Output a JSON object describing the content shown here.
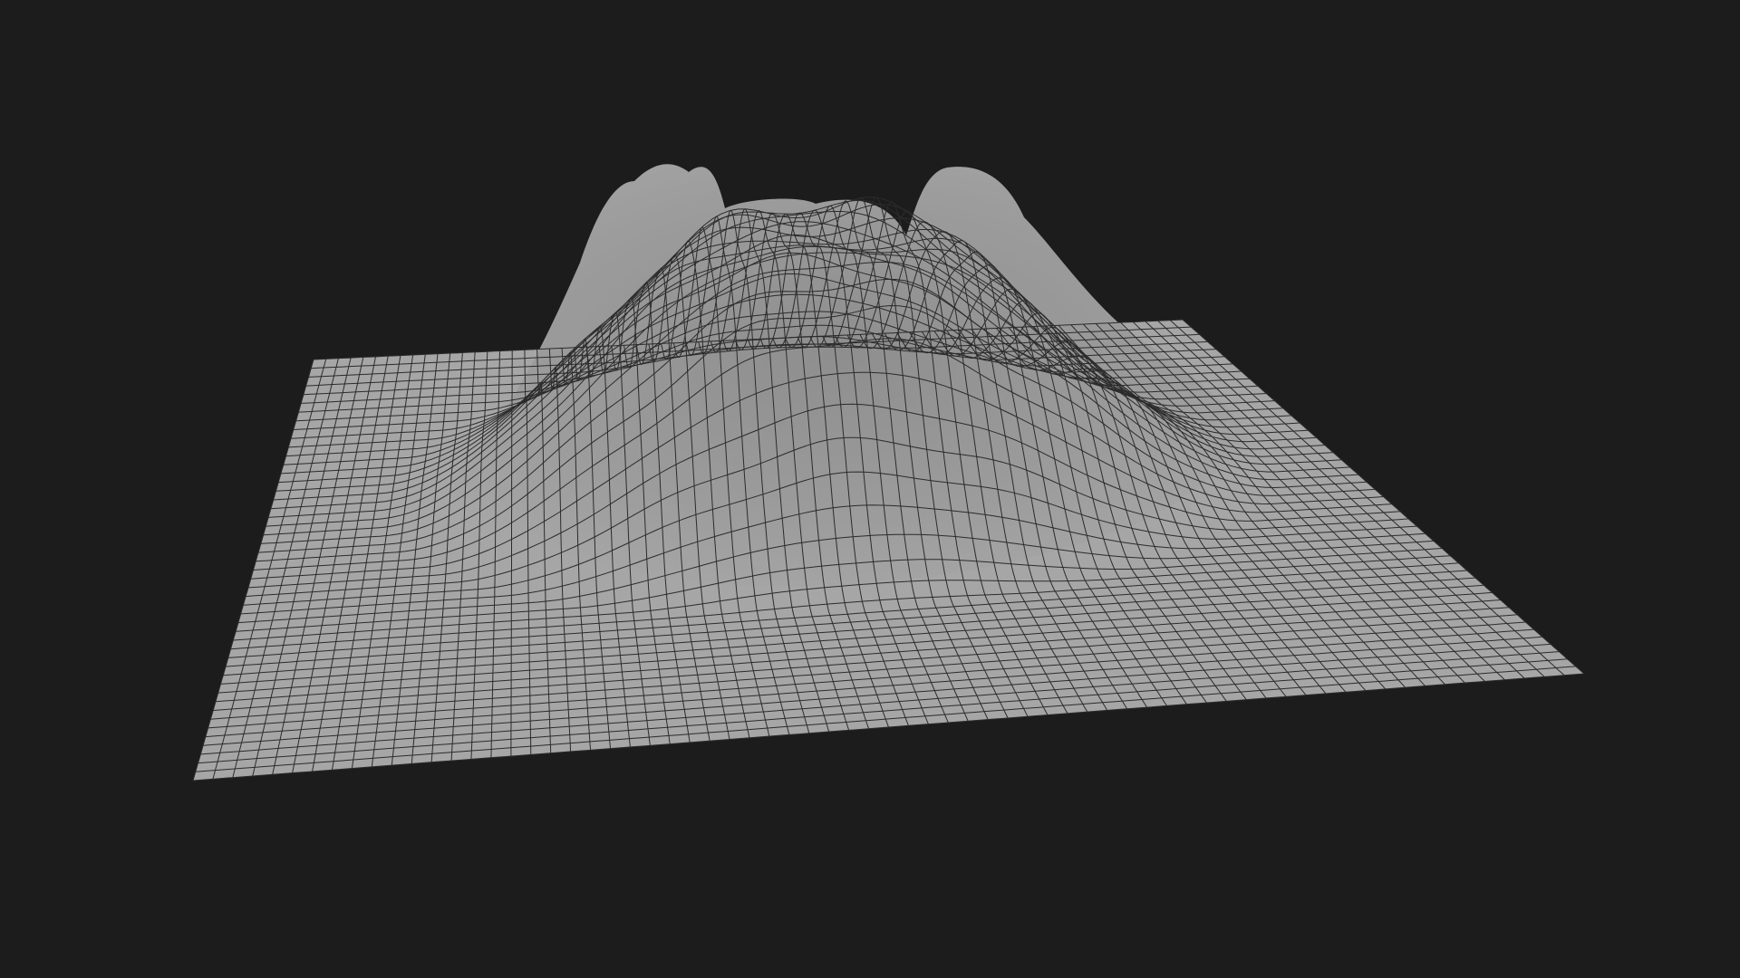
{
  "scene": {
    "background_color": "#1c1c1c",
    "surface_color": "#a3a3a3",
    "wire_color": "#2b2b2b",
    "subject": "volcano-terrain-wireframe-mesh",
    "render_mode": "wireframe-on-shaded"
  }
}
